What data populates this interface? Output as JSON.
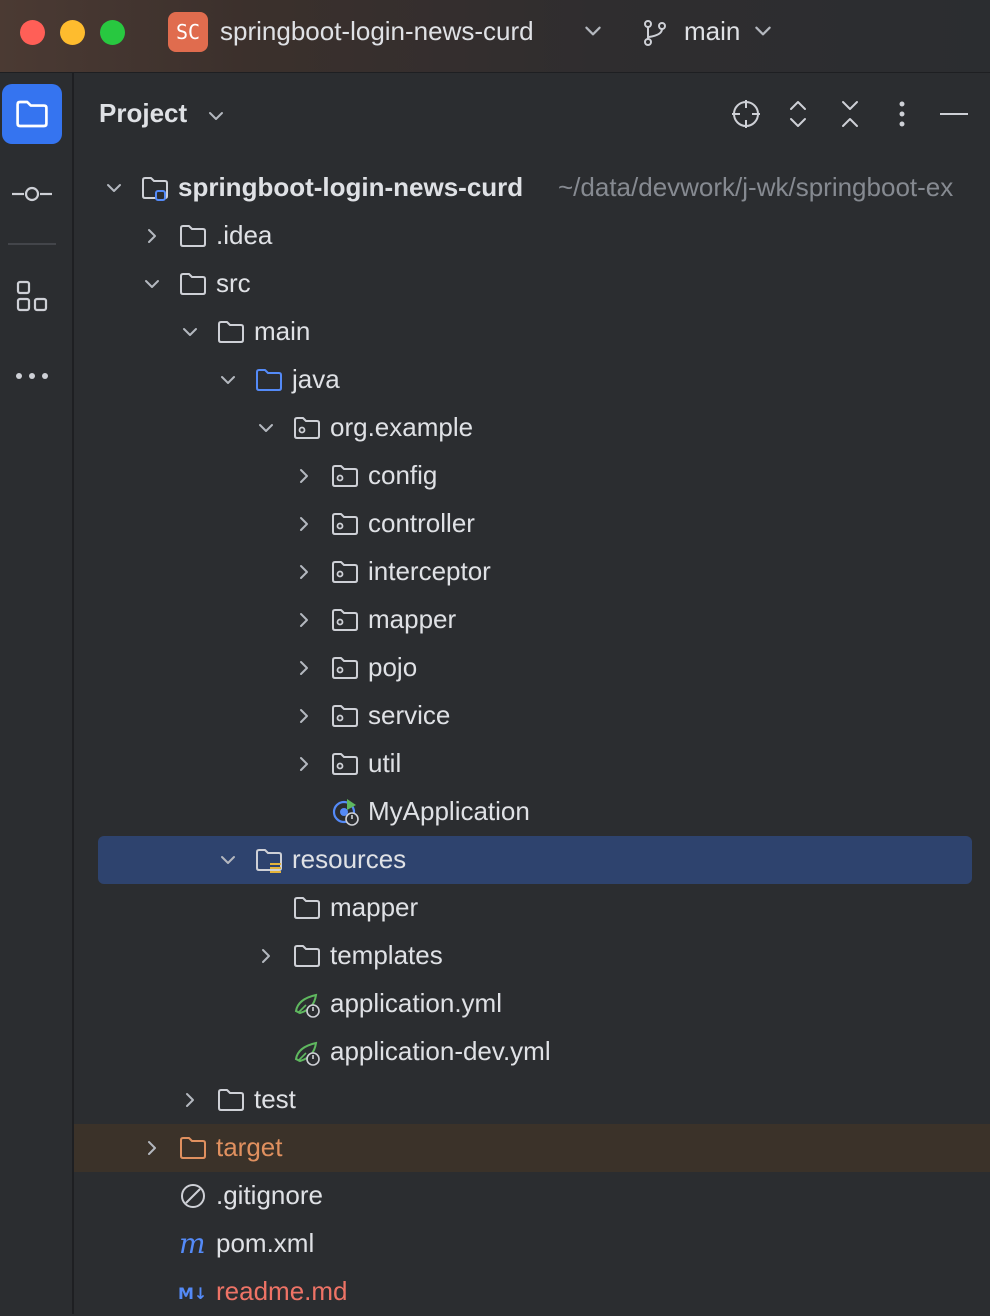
{
  "window": {
    "project_badge": "SC",
    "project_name": "springboot-login-news-curd",
    "branch": "main"
  },
  "panel": {
    "title": "Project",
    "header_icons": [
      "crosshair-icon",
      "expand-all-icon",
      "collapse-all-icon",
      "kebab-menu-icon",
      "minimize-icon"
    ]
  },
  "toolstrip": {
    "items": [
      "folder-icon",
      "commit-icon",
      "structure-icon",
      "more-icon"
    ]
  },
  "tree": {
    "root_name": "springboot-login-news-curd",
    "root_path": "~/data/devwork/j-wk/springboot-ex",
    "idea": ".idea",
    "src": "src",
    "main": "main",
    "java": "java",
    "org_example": "org.example",
    "config": "config",
    "controller": "controller",
    "interceptor": "interceptor",
    "mapper_pkg": "mapper",
    "pojo": "pojo",
    "service": "service",
    "util": "util",
    "my_application": "MyApplication",
    "resources": "resources",
    "mapper_dir": "mapper",
    "templates": "templates",
    "application_yml": "application.yml",
    "application_dev_yml": "application-dev.yml",
    "test": "test",
    "target": "target",
    "gitignore": ".gitignore",
    "pom": "pom.xml",
    "readme": "readme.md"
  },
  "colors": {
    "accent": "#3574f0",
    "selection": "#2e436e",
    "excluded_bg": "#3b3229",
    "excluded_text": "#e0905f",
    "readme_text": "#ee7366",
    "spring_green": "#5fb85f"
  }
}
